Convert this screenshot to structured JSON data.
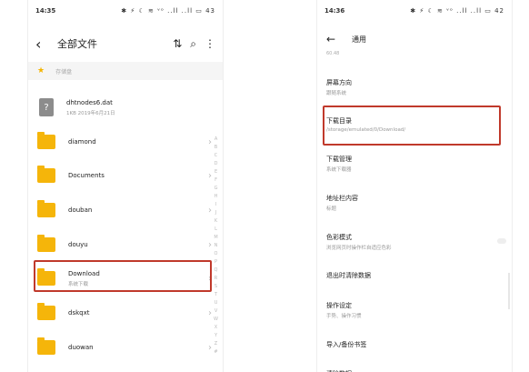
{
  "left_phone": {
    "status": {
      "time": "14:35",
      "icons": "✱ ⚡ ☾ ≋ ᵛᵒ ..ll ..ll ▭ 43"
    },
    "header": {
      "title": "全部文件"
    },
    "breadcrumb": {
      "text": "存储盘"
    },
    "files": [
      {
        "type": "doc",
        "name": "dhtnodes6.dat",
        "sub": "1KB  2019年6月21日"
      },
      {
        "type": "folder",
        "name": "diamond",
        "sub": ""
      },
      {
        "type": "folder",
        "name": "Documents",
        "sub": ""
      },
      {
        "type": "folder",
        "name": "douban",
        "sub": ""
      },
      {
        "type": "folder",
        "name": "douyu",
        "sub": ""
      },
      {
        "type": "folder",
        "name": "Download",
        "sub": "系统下载"
      },
      {
        "type": "folder",
        "name": "dskqxt",
        "sub": ""
      },
      {
        "type": "folder",
        "name": "duowan",
        "sub": ""
      }
    ],
    "alphabet": [
      "A",
      "B",
      "C",
      "D",
      "E",
      "F",
      "G",
      "H",
      "I",
      "J",
      "K",
      "L",
      "M",
      "N",
      "O",
      "P",
      "Q",
      "R",
      "S",
      "T",
      "U",
      "V",
      "W",
      "X",
      "Y",
      "Z",
      "#"
    ],
    "highlight_color": "#c0392b",
    "folder_color": "#f5b50a"
  },
  "right_phone": {
    "status": {
      "time": "14:36",
      "icons": "✱ ⚡ ☾ ≋ ᵛᵒ ..ll ..ll ▭ 42"
    },
    "header": {
      "title": "通用"
    },
    "top_partial": "60.48",
    "settings": [
      {
        "title": "屏幕方向",
        "sub": "跟随系统"
      },
      {
        "title": "下载目录",
        "sub": "/storage/emulated/0/Download/"
      },
      {
        "title": "下载管理",
        "sub": "系统下载器"
      },
      {
        "title": "地址栏内容",
        "sub": "标题"
      },
      {
        "title": "色彩模式",
        "sub": "浏览网页时操作栏自适应色彩"
      },
      {
        "title": "退出时清除数据",
        "sub": ""
      },
      {
        "title": "操作设定",
        "sub": "手势、操作习惯"
      },
      {
        "title": "导入/备份书签",
        "sub": ""
      },
      {
        "title": "清除数据",
        "sub": ""
      }
    ]
  }
}
